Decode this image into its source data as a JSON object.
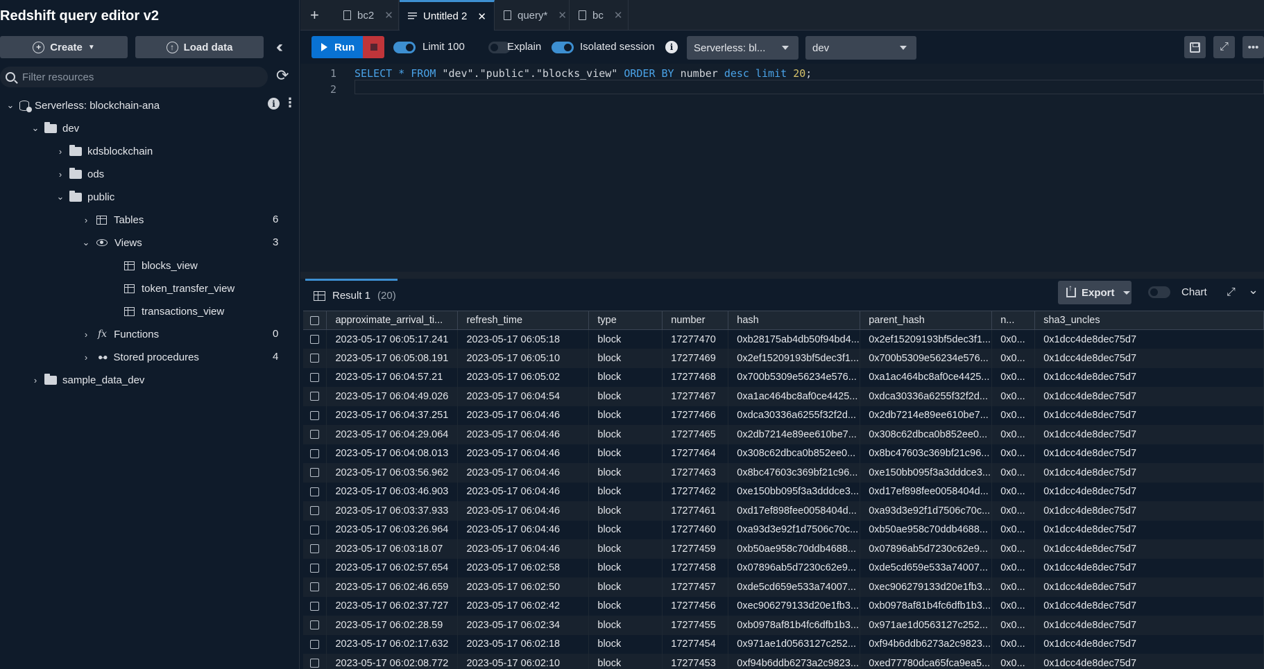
{
  "app": {
    "title": "Redshift query editor v2"
  },
  "sidebar": {
    "create_label": "Create",
    "load_label": "Load data",
    "filter_placeholder": "Filter resources",
    "tree": {
      "connection": "Serverless: blockchain-ana",
      "database": "dev",
      "schemas": [
        "kdsblockchain",
        "ods",
        "public"
      ],
      "tables_label": "Tables",
      "tables_count": "6",
      "views_label": "Views",
      "views_count": "3",
      "views": [
        "blocks_view",
        "token_transfer_view",
        "transactions_view"
      ],
      "functions_label": "Functions",
      "functions_count": "0",
      "procedures_label": "Stored procedures",
      "procedures_count": "4",
      "other_database": "sample_data_dev"
    }
  },
  "tabs": [
    {
      "label": "bc2",
      "active": false
    },
    {
      "label": "Untitled 2",
      "active": true
    },
    {
      "label": "query*",
      "active": false
    },
    {
      "label": "bc",
      "active": false
    }
  ],
  "toolbar": {
    "run_label": "Run",
    "limit_label": "Limit 100",
    "limit_on": true,
    "explain_label": "Explain",
    "explain_on": false,
    "isolated_label": "Isolated session",
    "isolated_on": true,
    "connection_select": "Serverless: bl...",
    "database_select": "dev"
  },
  "editor": {
    "line_numbers": [
      "1",
      "2"
    ],
    "sql": {
      "kw_select": "SELECT",
      "star": " * ",
      "kw_from": "FROM",
      "target": " \"dev\".\"public\".\"blocks_view\" ",
      "kw_order": "ORDER BY",
      "col": " number ",
      "kw_desc": "desc",
      "sp": " ",
      "kw_limit": "limit",
      "sp2": " ",
      "limit_value": "20",
      "end": ";"
    }
  },
  "results": {
    "tab_label": "Result 1",
    "tab_count": "(20)",
    "export_label": "Export",
    "chart_label": "Chart",
    "columns": [
      "approximate_arrival_ti...",
      "refresh_time",
      "type",
      "number",
      "hash",
      "parent_hash",
      "n...",
      "sha3_uncles"
    ],
    "rows": [
      [
        "2023-05-17 06:05:17.241",
        "2023-05-17 06:05:18",
        "block",
        "17277470",
        "0xb28175ab4db50f94bd4...",
        "0x2ef15209193bf5dec3f1...",
        "0x0...",
        "0x1dcc4de8dec75d7"
      ],
      [
        "2023-05-17 06:05:08.191",
        "2023-05-17 06:05:10",
        "block",
        "17277469",
        "0x2ef15209193bf5dec3f1...",
        "0x700b5309e56234e576...",
        "0x0...",
        "0x1dcc4de8dec75d7"
      ],
      [
        "2023-05-17 06:04:57.21",
        "2023-05-17 06:05:02",
        "block",
        "17277468",
        "0x700b5309e56234e576...",
        "0xa1ac464bc8af0ce4425...",
        "0x0...",
        "0x1dcc4de8dec75d7"
      ],
      [
        "2023-05-17 06:04:49.026",
        "2023-05-17 06:04:54",
        "block",
        "17277467",
        "0xa1ac464bc8af0ce4425...",
        "0xdca30336a6255f32f2d...",
        "0x0...",
        "0x1dcc4de8dec75d7"
      ],
      [
        "2023-05-17 06:04:37.251",
        "2023-05-17 06:04:46",
        "block",
        "17277466",
        "0xdca30336a6255f32f2d...",
        "0x2db7214e89ee610be7...",
        "0x0...",
        "0x1dcc4de8dec75d7"
      ],
      [
        "2023-05-17 06:04:29.064",
        "2023-05-17 06:04:46",
        "block",
        "17277465",
        "0x2db7214e89ee610be7...",
        "0x308c62dbca0b852ee0...",
        "0x0...",
        "0x1dcc4de8dec75d7"
      ],
      [
        "2023-05-17 06:04:08.013",
        "2023-05-17 06:04:46",
        "block",
        "17277464",
        "0x308c62dbca0b852ee0...",
        "0x8bc47603c369bf21c96...",
        "0x0...",
        "0x1dcc4de8dec75d7"
      ],
      [
        "2023-05-17 06:03:56.962",
        "2023-05-17 06:04:46",
        "block",
        "17277463",
        "0x8bc47603c369bf21c96...",
        "0xe150bb095f3a3dddce3...",
        "0x0...",
        "0x1dcc4de8dec75d7"
      ],
      [
        "2023-05-17 06:03:46.903",
        "2023-05-17 06:04:46",
        "block",
        "17277462",
        "0xe150bb095f3a3dddce3...",
        "0xd17ef898fee0058404d...",
        "0x0...",
        "0x1dcc4de8dec75d7"
      ],
      [
        "2023-05-17 06:03:37.933",
        "2023-05-17 06:04:46",
        "block",
        "17277461",
        "0xd17ef898fee0058404d...",
        "0xa93d3e92f1d7506c70c...",
        "0x0...",
        "0x1dcc4de8dec75d7"
      ],
      [
        "2023-05-17 06:03:26.964",
        "2023-05-17 06:04:46",
        "block",
        "17277460",
        "0xa93d3e92f1d7506c70c...",
        "0xb50ae958c70ddb4688...",
        "0x0...",
        "0x1dcc4de8dec75d7"
      ],
      [
        "2023-05-17 06:03:18.07",
        "2023-05-17 06:04:46",
        "block",
        "17277459",
        "0xb50ae958c70ddb4688...",
        "0x07896ab5d7230c62e9...",
        "0x0...",
        "0x1dcc4de8dec75d7"
      ],
      [
        "2023-05-17 06:02:57.654",
        "2023-05-17 06:02:58",
        "block",
        "17277458",
        "0x07896ab5d7230c62e9...",
        "0xde5cd659e533a74007...",
        "0x0...",
        "0x1dcc4de8dec75d7"
      ],
      [
        "2023-05-17 06:02:46.659",
        "2023-05-17 06:02:50",
        "block",
        "17277457",
        "0xde5cd659e533a74007...",
        "0xec906279133d20e1fb3...",
        "0x0...",
        "0x1dcc4de8dec75d7"
      ],
      [
        "2023-05-17 06:02:37.727",
        "2023-05-17 06:02:42",
        "block",
        "17277456",
        "0xec906279133d20e1fb3...",
        "0xb0978af81b4fc6dfb1b3...",
        "0x0...",
        "0x1dcc4de8dec75d7"
      ],
      [
        "2023-05-17 06:02:28.59",
        "2023-05-17 06:02:34",
        "block",
        "17277455",
        "0xb0978af81b4fc6dfb1b3...",
        "0x971ae1d0563127c252...",
        "0x0...",
        "0x1dcc4de8dec75d7"
      ],
      [
        "2023-05-17 06:02:17.632",
        "2023-05-17 06:02:18",
        "block",
        "17277454",
        "0x971ae1d0563127c252...",
        "0xf94b6ddb6273a2c9823...",
        "0x0...",
        "0x1dcc4de8dec75d7"
      ],
      [
        "2023-05-17 06:02:08.772",
        "2023-05-17 06:02:10",
        "block",
        "17277453",
        "0xf94b6ddb6273a2c9823...",
        "0xed77780dca65fca9ea5...",
        "0x0...",
        "0x1dcc4de8dec75d7"
      ]
    ]
  }
}
